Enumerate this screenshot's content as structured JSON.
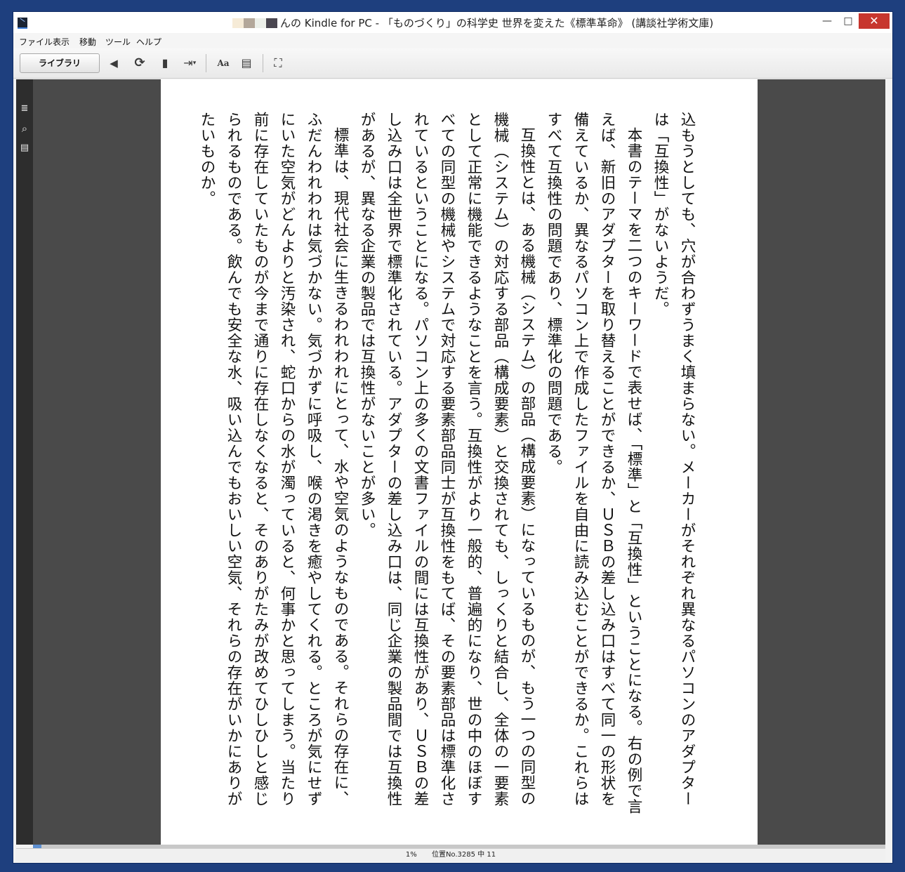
{
  "window": {
    "title": "んの Kindle for PC - 「ものづくり」の科学史 世界を変えた《標準革命》 (講談社学術文庫)",
    "title_redaction_colors": [
      "#f6ebd7",
      "#b3a79a",
      "#ecefe9",
      "#4a4650"
    ],
    "controls": {
      "minimize": "—",
      "maximize": "□",
      "close": "✕"
    },
    "frame_color": "#1e3f7e"
  },
  "menu": {
    "items": [
      "ファイル",
      "表示",
      "移動",
      "ツール",
      "ヘルプ"
    ]
  },
  "toolbar": {
    "library_label": "ライブラリ",
    "icons": [
      "back-icon",
      "sync-icon",
      "bookmark-icon",
      "goto-icon",
      "font-icon",
      "layout-icon",
      "fullscreen-icon"
    ],
    "back_glyph": "◀",
    "sync_glyph": "⟳",
    "bookmark_glyph": "▮",
    "goto_glyph": "⇥",
    "dropdown_glyph": "▾",
    "font_label": "Aa",
    "layout_glyph": "▤",
    "fullscreen_glyph": "⛶"
  },
  "sidebar": {
    "icons": [
      "toc-icon",
      "search-icon",
      "notes-icon"
    ],
    "toc_glyph": "≣",
    "search_glyph": "⌕",
    "notes_glyph": "▤"
  },
  "book": {
    "paragraphs": [
      {
        "indent": false,
        "text": "込もうとしても、穴が合わずうまく填まらない。メーカーがそれぞれ異なるパソコンのアダプターは「互換性」がないようだ。"
      },
      {
        "indent": true,
        "text": "本書のテーマを二つのキーワードで表せば、「標準」と「互換性」ということになる。右の例で言えば、新旧のアダプターを取り替えることができるか、ＵＳＢの差し込み口はすべて同一の形状を備えているか、異なるパソコン上で作成したファイルを自由に読み込むことができるか。これらはすべて互換性の問題であり、標準化の問題である。"
      },
      {
        "indent": true,
        "text": "互換性とは、ある機械（システム）の部品（構成要素）になっているものが、もう一つの同型の機械（システム）の対応する部品（構成要素）と交換されても、しっくりと結合し、全体の一要素として正常に機能できるようなことを言う。互換性がより一般的、普遍的になり、世の中のほぼすべての同型の機械やシステムで対応する要素部品同士が互換性をもてば、その要素部品は標準化されているということになる。パソコン上の多くの文書ファイルの間には互換性があり、ＵＳＢの差し込み口は全世界で標準化されている。アダプターの差し込み口は、同じ企業の製品間では互換性があるが、異なる企業の製品では互換性がないことが多い。"
      },
      {
        "indent": true,
        "text": "標準は、現代社会に生きるわれわれにとって、水や空気のようなものである。それらの存在に、ふだんわれわれは気づかない。気づかずに呼吸し、喉の渇きを癒やしてくれる。ところが気にせずにいた空気がどんよりと汚染され、蛇口からの水が濁っていると、何事かと思ってしまう。当たり前に存在していたものが今まで通りに存在しなくなると、そのありがたみが改めてひしひしと感じられるものである。飲んでも安全な水、吸い込んでもおいしい空気、それらの存在がいかにありがたいものか。"
      }
    ]
  },
  "status": {
    "percent_label": "1%",
    "location_label": "位置No.3285 中 11",
    "progress_fraction": 0.01
  }
}
